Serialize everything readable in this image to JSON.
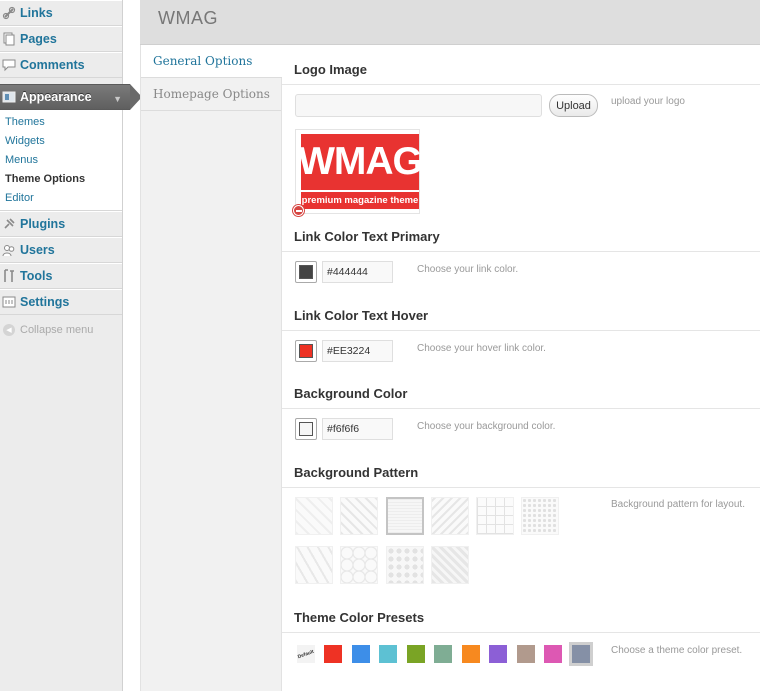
{
  "sidebar": {
    "items": [
      {
        "label": "Links",
        "icon": "links-icon"
      },
      {
        "label": "Pages",
        "icon": "pages-icon"
      },
      {
        "label": "Comments",
        "icon": "comments-icon"
      },
      {
        "label": "Appearance",
        "icon": "appearance-icon"
      },
      {
        "label": "Plugins",
        "icon": "plugins-icon"
      },
      {
        "label": "Users",
        "icon": "users-icon"
      },
      {
        "label": "Tools",
        "icon": "tools-icon"
      },
      {
        "label": "Settings",
        "icon": "settings-icon"
      }
    ],
    "appearance_submenu": [
      "Themes",
      "Widgets",
      "Menus",
      "Theme Options",
      "Editor"
    ],
    "current_submenu": "Theme Options",
    "collapse_label": "Collapse menu"
  },
  "header": {
    "title": "WMAG"
  },
  "tabs": [
    {
      "label": "General Options",
      "active": true
    },
    {
      "label": "Homepage Options",
      "active": false
    }
  ],
  "logo": {
    "section_title": "Logo Image",
    "input_value": "",
    "upload_label": "Upload",
    "description": "upload your logo",
    "logo_text": "WMAG",
    "logo_tagline": "premium magazine theme"
  },
  "link_primary": {
    "title": "Link Color Text Primary",
    "value": "#444444",
    "description": "Choose your link color.",
    "swatch": "#444444"
  },
  "link_hover": {
    "title": "Link Color Text Hover",
    "value": "#EE3224",
    "description": "Choose your hover link color.",
    "swatch": "#EE3224"
  },
  "background": {
    "title": "Background Color",
    "value": "#f6f6f6",
    "description": "Choose your background color.",
    "swatch": "#f6f6f6"
  },
  "pattern": {
    "title": "Background Pattern",
    "description": "Background pattern for layout.",
    "count": 10,
    "selected_index": 2
  },
  "presets": {
    "title": "Theme Color Presets",
    "description": "Choose a theme color preset.",
    "first_label": "Default",
    "colors": [
      "#ee3224",
      "#3d8ee8",
      "#5dc1d3",
      "#7aa425",
      "#7fad94",
      "#f7891f",
      "#8c5fd6",
      "#b19a8d",
      "#dd58b3",
      "#8590a6"
    ],
    "selected_index": 9
  },
  "colors": {
    "link": "#21759b",
    "accent_red": "#e83331"
  }
}
